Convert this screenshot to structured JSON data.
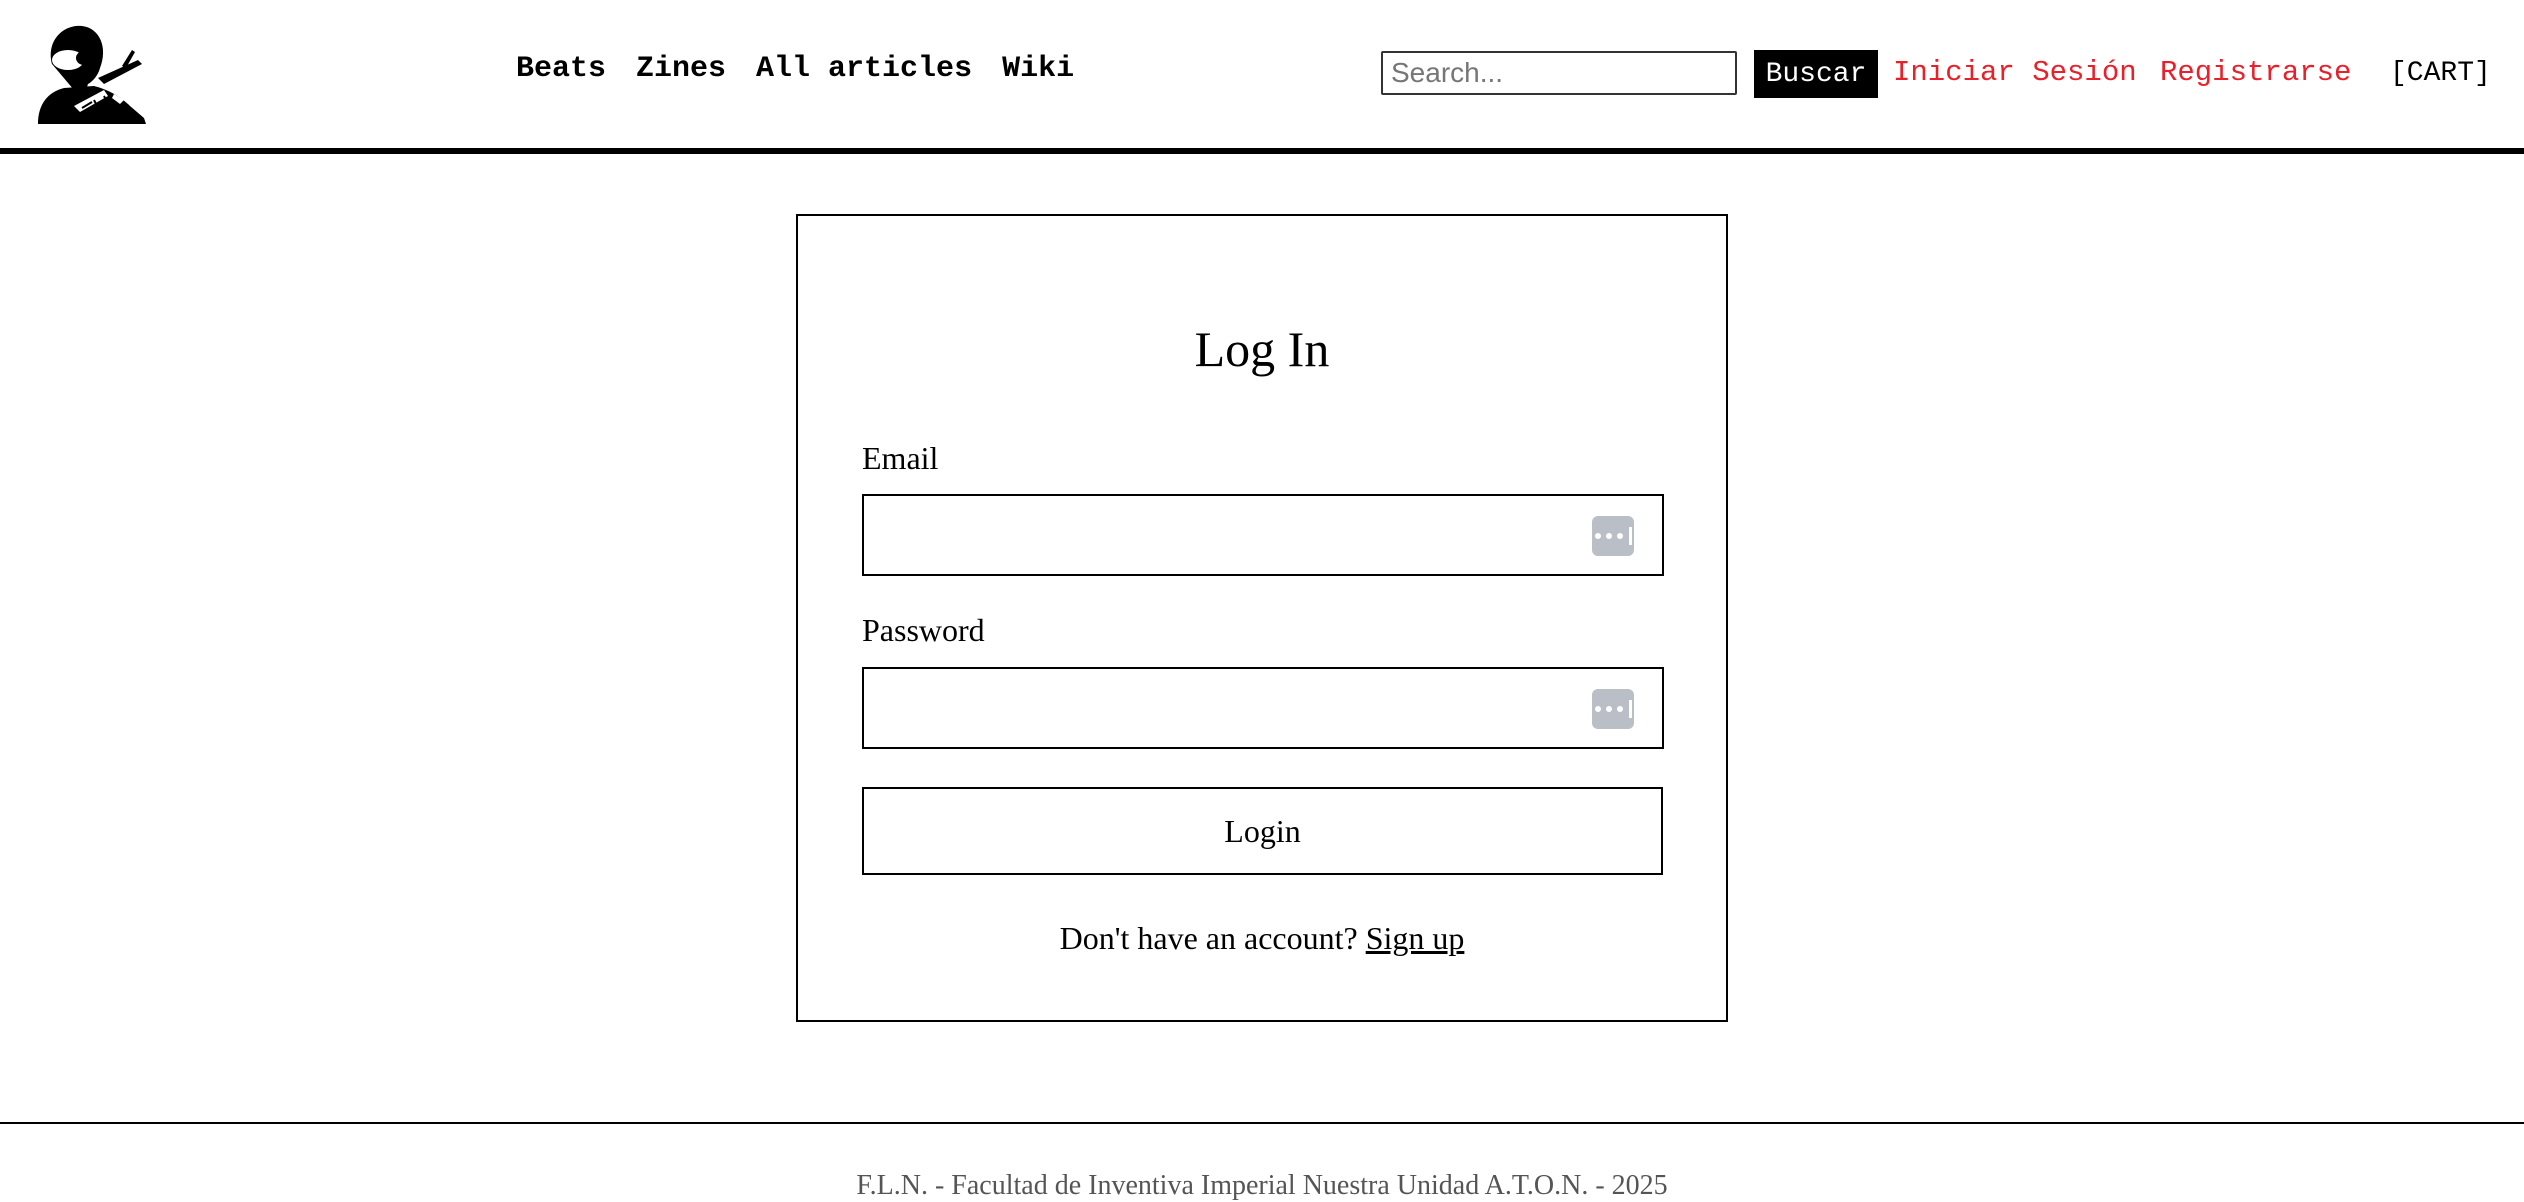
{
  "header": {
    "logo_icon": "masked-figure-logo",
    "nav": [
      {
        "label": "Beats"
      },
      {
        "label": "Zines"
      },
      {
        "label": "All articles"
      },
      {
        "label": "Wiki"
      }
    ],
    "search": {
      "placeholder": "Search...",
      "value": "",
      "button_label": "Buscar"
    },
    "login_label": "Iniciar Sesión",
    "register_label": "Registrarse",
    "cart_label": "[CART]",
    "link_color": "#e8202a"
  },
  "login_form": {
    "title": "Log In",
    "email_label": "Email",
    "email_value": "",
    "password_label": "Password",
    "password_value": "",
    "field_icon": "password-manager-icon",
    "submit_label": "Login",
    "signup_prompt": "Don't have an account?",
    "signup_link": "Sign up"
  },
  "footer": {
    "text": "F.L.N. - Facultad de Inventiva Imperial Nuestra Unidad A.T.O.N. - 2025"
  }
}
